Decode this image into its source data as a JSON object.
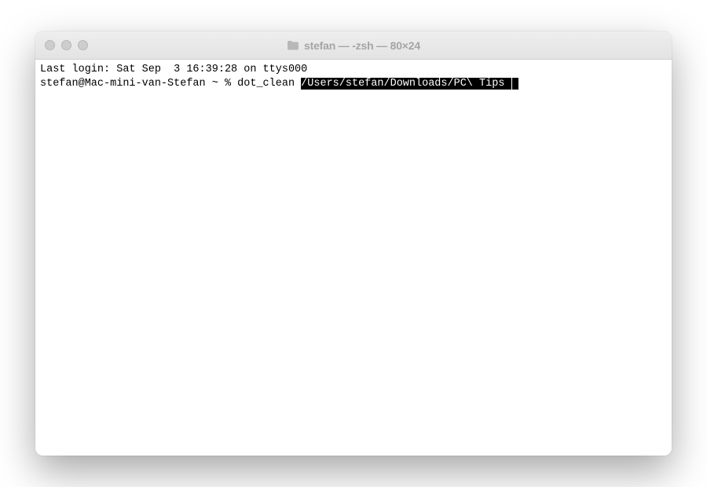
{
  "window": {
    "title": "stefan — -zsh — 80×24"
  },
  "terminal": {
    "last_login": "Last login: Sat Sep  3 16:39:28 on ttys000",
    "prompt": "stefan@Mac-mini-van-Stefan ~ % ",
    "command": "dot_clean ",
    "highlighted_path": "/Users/stefan/Downloads/PC\\ Tips "
  }
}
